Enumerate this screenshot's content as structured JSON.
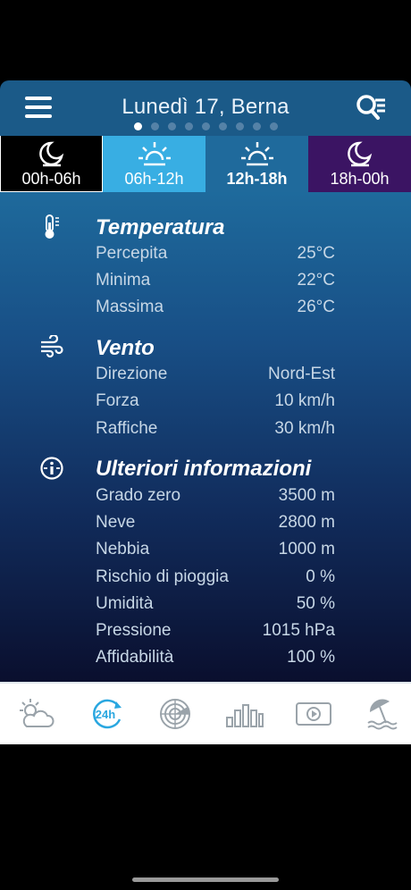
{
  "header": {
    "title": "Lunedì 17, Berna",
    "page_count": 9,
    "active_page": 1
  },
  "tabs": [
    {
      "label": "00h-06h",
      "icon": "moon-icon"
    },
    {
      "label": "06h-12h",
      "icon": "sunrise-icon"
    },
    {
      "label": "12h-18h",
      "icon": "sun-icon"
    },
    {
      "label": "18h-00h",
      "icon": "moon-icon"
    }
  ],
  "temperature": {
    "title": "Temperatura",
    "rows": [
      {
        "label": "Percepita",
        "value": "25°C"
      },
      {
        "label": "Minima",
        "value": "22°C"
      },
      {
        "label": "Massima",
        "value": "26°C"
      }
    ]
  },
  "wind": {
    "title": "Vento",
    "rows": [
      {
        "label": "Direzione",
        "value": "Nord-Est"
      },
      {
        "label": "Forza",
        "value": "10 km/h"
      },
      {
        "label": "Raffiche",
        "value": "30 km/h"
      }
    ]
  },
  "info": {
    "title": "Ulteriori informazioni",
    "rows": [
      {
        "label": "Grado zero",
        "value": "3500 m"
      },
      {
        "label": "Neve",
        "value": "2800 m"
      },
      {
        "label": "Nebbia",
        "value": "1000 m"
      },
      {
        "label": "Rischio di pioggia",
        "value": "0 %"
      },
      {
        "label": "Umidità",
        "value": "50 %"
      },
      {
        "label": "Pressione",
        "value": "1015 hPa"
      },
      {
        "label": "Affidabilità",
        "value": "100 %"
      }
    ]
  },
  "bottom_nav": {
    "items": [
      {
        "icon": "weather-icon"
      },
      {
        "icon": "24h-icon",
        "label": "24h"
      },
      {
        "icon": "radar-icon"
      },
      {
        "icon": "chart-icon"
      },
      {
        "icon": "video-icon"
      },
      {
        "icon": "beach-icon"
      }
    ],
    "active_index": 1
  },
  "colors": {
    "header_bg": "#1b5a88",
    "tab_morning": "#38aee3",
    "tab_active": "#1f6a9c",
    "tab_evening": "#3b1463",
    "nav_active": "#2aa7e0"
  }
}
